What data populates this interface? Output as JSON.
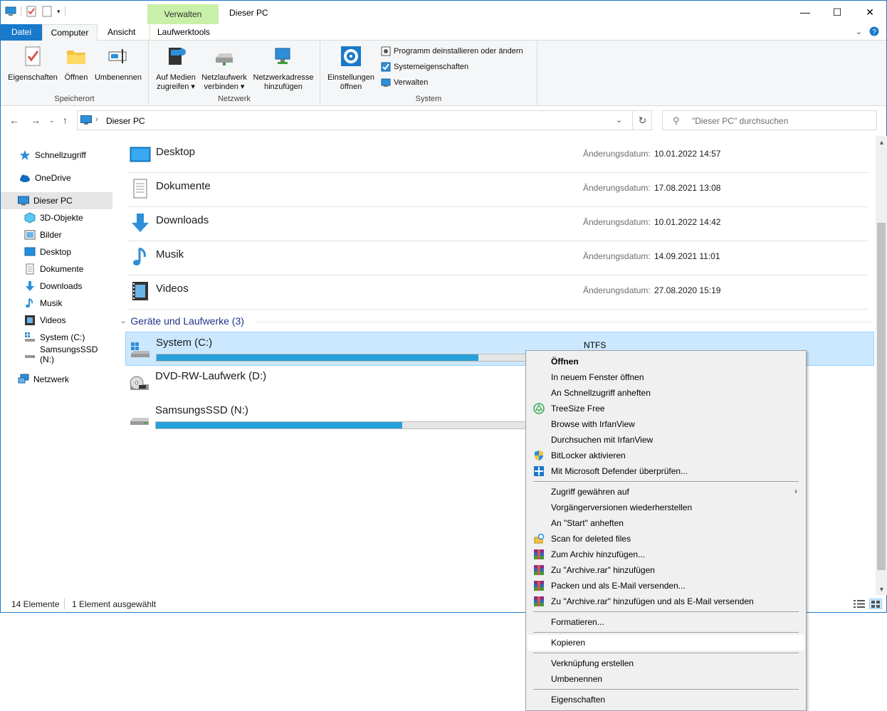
{
  "window": {
    "title": "Dieser PC",
    "context_tab_header": "Verwalten",
    "controls": {
      "minimize": "—",
      "maximize": "☐",
      "close": "✕"
    }
  },
  "ribbon_tabs": {
    "file": "Datei",
    "computer": "Computer",
    "view": "Ansicht",
    "drive_tools": "Laufwerktools"
  },
  "ribbon": {
    "groups": {
      "location": {
        "label": "Speicherort",
        "buttons": [
          "Eigenschaften",
          "Öffnen",
          "Umbenennen"
        ]
      },
      "network": {
        "label": "Netzwerk",
        "media": [
          "Auf Medien",
          "zugreifen ▾"
        ],
        "map_drive": [
          "Netzlaufwerk",
          "verbinden ▾"
        ],
        "add_location": [
          "Netzwerkadresse",
          "hinzufügen"
        ]
      },
      "system": {
        "label": "System",
        "settings": [
          "Einstellungen",
          "öffnen"
        ],
        "small": [
          "Programm deinstallieren oder ändern",
          "Systemeigenschaften",
          "Verwalten"
        ]
      }
    }
  },
  "address": {
    "crumb": "Dieser PC",
    "search_placeholder": "\"Dieser PC\" durchsuchen"
  },
  "nav_pane": {
    "items": [
      {
        "label": "Schnellzugriff",
        "icon": "star-icon"
      },
      {
        "label": "OneDrive",
        "icon": "cloud-icon"
      },
      {
        "label": "Dieser PC",
        "icon": "pc-icon"
      },
      {
        "label": "3D-Objekte",
        "icon": "cube-icon"
      },
      {
        "label": "Bilder",
        "icon": "pictures-icon"
      },
      {
        "label": "Desktop",
        "icon": "desktop-icon"
      },
      {
        "label": "Dokumente",
        "icon": "document-icon"
      },
      {
        "label": "Downloads",
        "icon": "download-icon"
      },
      {
        "label": "Musik",
        "icon": "music-icon"
      },
      {
        "label": "Videos",
        "icon": "video-icon"
      },
      {
        "label": "System (C:)",
        "icon": "system-drive-icon"
      },
      {
        "label": "SamsungsSSD (N:)",
        "icon": "drive-icon"
      },
      {
        "label": "Netzwerk",
        "icon": "network-icon"
      }
    ]
  },
  "folders": {
    "date_label": "Änderungsdatum:",
    "items": [
      {
        "name": "Desktop",
        "date": "10.01.2022 14:57",
        "icon": "desktop-folder-icon"
      },
      {
        "name": "Dokumente",
        "date": "17.08.2021 13:08",
        "icon": "documents-folder-icon"
      },
      {
        "name": "Downloads",
        "date": "10.01.2022 14:42",
        "icon": "downloads-folder-icon"
      },
      {
        "name": "Musik",
        "date": "14.09.2021 11:01",
        "icon": "music-folder-icon"
      },
      {
        "name": "Videos",
        "date": "27.08.2020 15:19",
        "icon": "videos-folder-icon"
      }
    ]
  },
  "devices": {
    "group_header": "Geräte und Laufwerke (3)",
    "items": [
      {
        "name": "System (C:)",
        "fs": "NTFS",
        "used_fraction": 0.81
      },
      {
        "name": "DVD-RW-Laufwerk (D:)"
      },
      {
        "name": "SamsungsSSD (N:)",
        "used_fraction": 0.62
      }
    ]
  },
  "status": {
    "count": "14 Elemente",
    "selection": "1 Element ausgewählt"
  },
  "context_menu": {
    "items": [
      {
        "label": "Öffnen",
        "bold": true
      },
      {
        "label": "In neuem Fenster öffnen"
      },
      {
        "label": "An Schnellzugriff anheften"
      },
      {
        "label": "TreeSize Free",
        "icon": "treesize-icon"
      },
      {
        "label": "Browse with IrfanView"
      },
      {
        "label": "Durchsuchen mit IrfanView"
      },
      {
        "label": "BitLocker aktivieren",
        "icon": "shield-icon"
      },
      {
        "label": "Mit Microsoft Defender überprüfen...",
        "icon": "defender-icon"
      },
      {
        "label": "Zugriff gewähren auf",
        "submenu": "›"
      },
      {
        "label": "Vorgängerversionen wiederherstellen"
      },
      {
        "label": "An \"Start\" anheften"
      },
      {
        "label": "Scan for deleted files",
        "icon": "recovery-icon"
      },
      {
        "label": "Zum Archiv hinzufügen...",
        "icon": "winrar-icon"
      },
      {
        "label": "Zu \"Archive.rar\" hinzufügen",
        "icon": "winrar-icon"
      },
      {
        "label": "Packen und als E-Mail versenden...",
        "icon": "winrar-icon"
      },
      {
        "label": "Zu \"Archive.rar\" hinzufügen und als E-Mail versenden",
        "icon": "winrar-icon"
      },
      {
        "label": "Formatieren..."
      },
      {
        "label": "Kopieren",
        "highlighted": true
      },
      {
        "label": "Verknüpfung erstellen"
      },
      {
        "label": "Umbenennen"
      },
      {
        "label": "Eigenschaften"
      }
    ]
  },
  "colors": {
    "accent": "#1979ca",
    "selection": "#cce8ff",
    "context_tab": "#c9f0a9",
    "progress": "#26a0da"
  }
}
